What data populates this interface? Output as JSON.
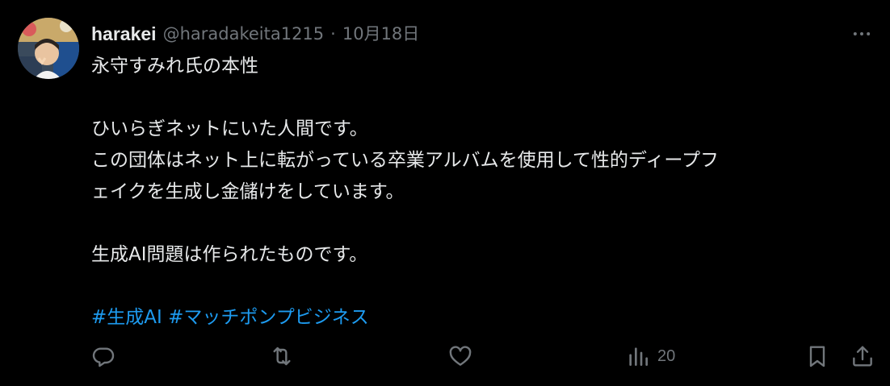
{
  "tweet": {
    "author": {
      "display_name": "harakei",
      "handle": "@haradakeita1215",
      "separator": "·",
      "date": "10月18日"
    },
    "body_lines": [
      "永守すみれ氏の本性",
      "",
      "ひいらぎネットにいた人間です。",
      "この団体はネット上に転がっている卒業アルバムを使用して性的ディープフ",
      "ェイクを生成し金儲けをしています。",
      "",
      "生成AI問題は作られたものです。",
      ""
    ],
    "hashtags": [
      "#生成AI",
      "#マッチポンプビジネス"
    ],
    "actions": {
      "views_count": "20"
    }
  },
  "colors": {
    "background": "#000000",
    "text": "#e7e9ea",
    "muted": "#71767b",
    "link": "#1d9bf0"
  },
  "icons": {
    "more": "more-horizontal-icon",
    "reply": "reply-icon",
    "retweet": "retweet-icon",
    "like": "heart-icon",
    "views": "views-chart-icon",
    "bookmark": "bookmark-icon",
    "share": "share-icon"
  }
}
